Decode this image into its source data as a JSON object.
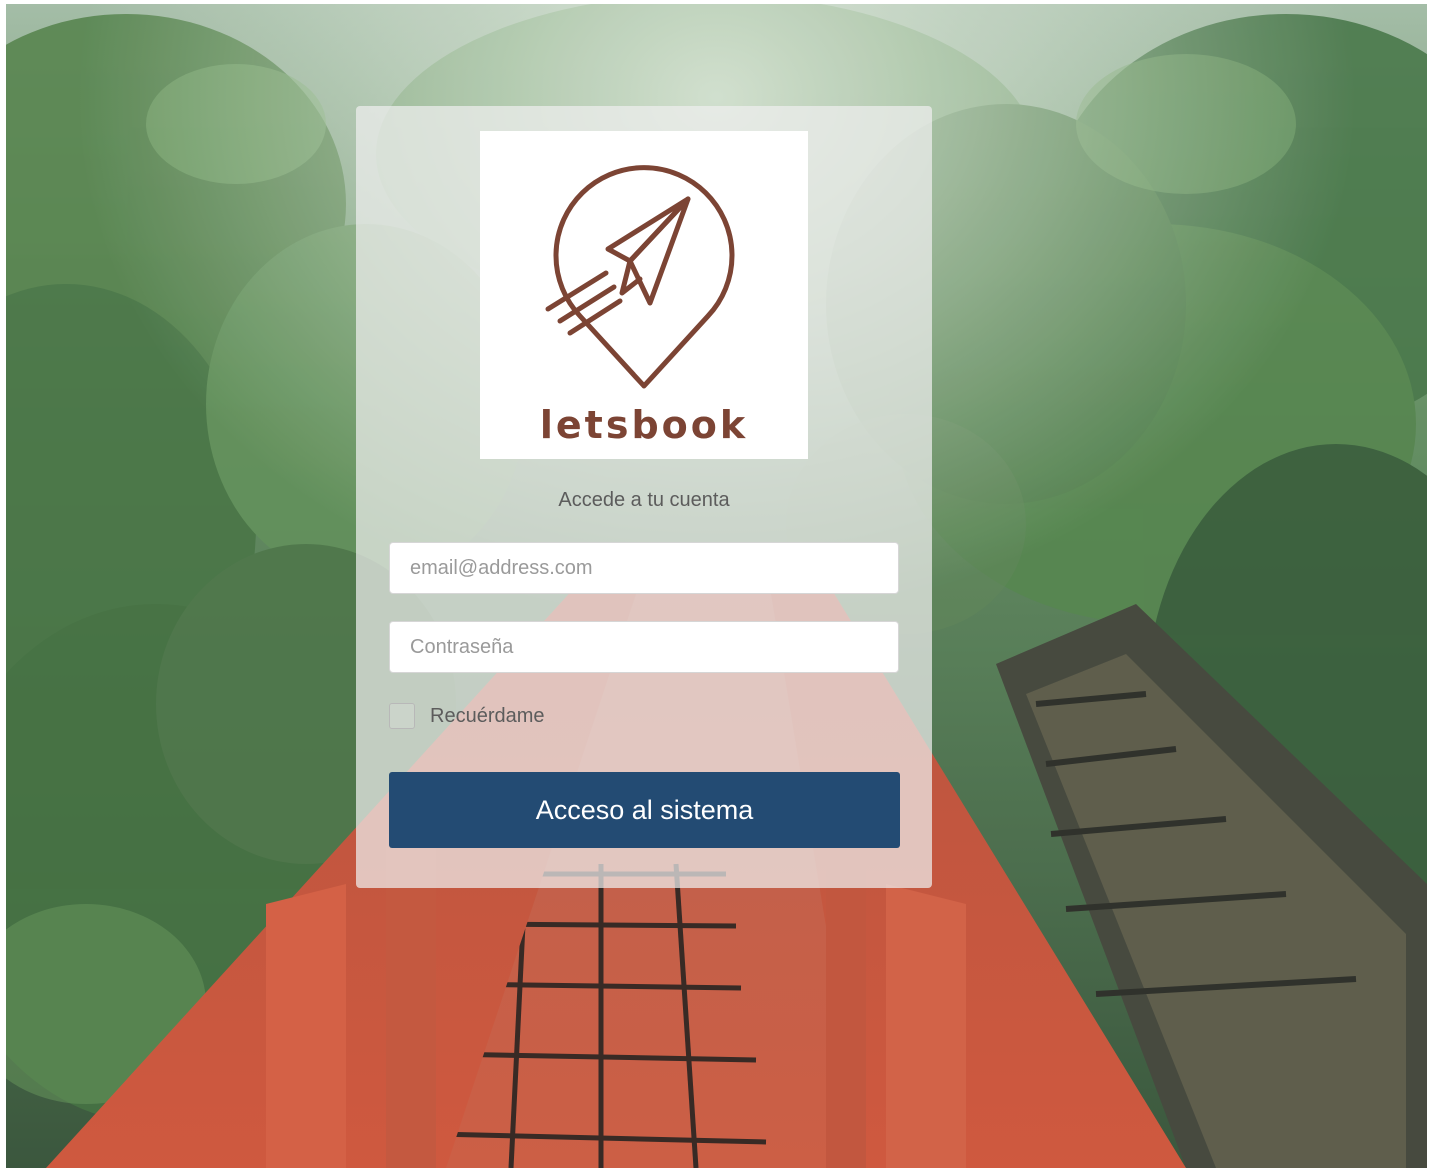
{
  "brand": {
    "name": "letsbook",
    "logo_color": "#7c4434"
  },
  "login": {
    "subtitle": "Accede a tu cuenta",
    "email_placeholder": "email@address.com",
    "password_placeholder": "Contraseña",
    "remember_label": "Recuérdame",
    "remember_checked": false,
    "submit_label": "Acceso al sistema"
  },
  "theme": {
    "button_color": "#234b73",
    "background": "forest bridge photo"
  }
}
